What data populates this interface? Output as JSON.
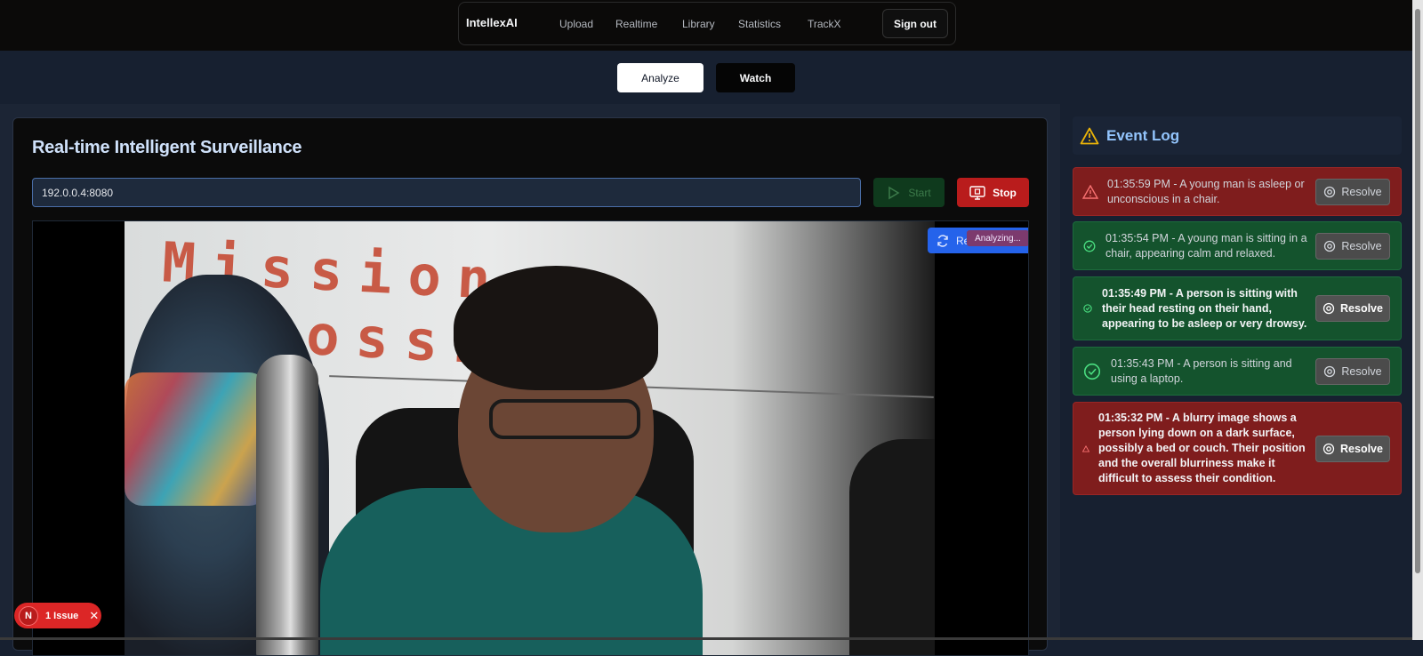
{
  "nav": {
    "brand": "IntellexAI",
    "links": [
      "Upload",
      "Realtime",
      "Library",
      "Statistics",
      "TrackX"
    ],
    "sign_out": "Sign out"
  },
  "mode_tabs": {
    "analyze": "Analyze",
    "watch": "Watch"
  },
  "panel": {
    "title": "Real-time Intelligent Surveillance",
    "stream_url": "192.0.0.4:8080",
    "start_label": "Start",
    "stop_label": "Stop",
    "reload_label": "Reload",
    "analyzing_label": "Analyzing...",
    "frame_text": "Mission Impossible"
  },
  "event_log": {
    "title": "Event Log",
    "resolve_label": "Resolve",
    "events": [
      {
        "text": "01:35:59 PM - A young man is asleep or unconscious in a chair.",
        "status": "alert"
      },
      {
        "text": "01:35:54 PM - A young man is sitting in a chair, appearing calm and relaxed.",
        "status": "ok"
      },
      {
        "text": "01:35:49 PM - A person is sitting with their head resting on their hand, appearing to be asleep or very drowsy.",
        "status": "ok"
      },
      {
        "text": "01:35:43 PM - A person is sitting and using a laptop.",
        "status": "ok"
      },
      {
        "text": "01:35:32 PM - A blurry image shows a person lying down on a dark surface, possibly a bed or couch. Their position and the overall blurriness make it difficult to assess their condition.",
        "status": "alert"
      }
    ]
  },
  "issue_badge": {
    "icon_letter": "N",
    "label": "1 Issue"
  },
  "colors": {
    "alert": "#7f1d1d",
    "ok": "#14532d",
    "accent": "#93c5fd",
    "stop": "#b91c1c"
  }
}
